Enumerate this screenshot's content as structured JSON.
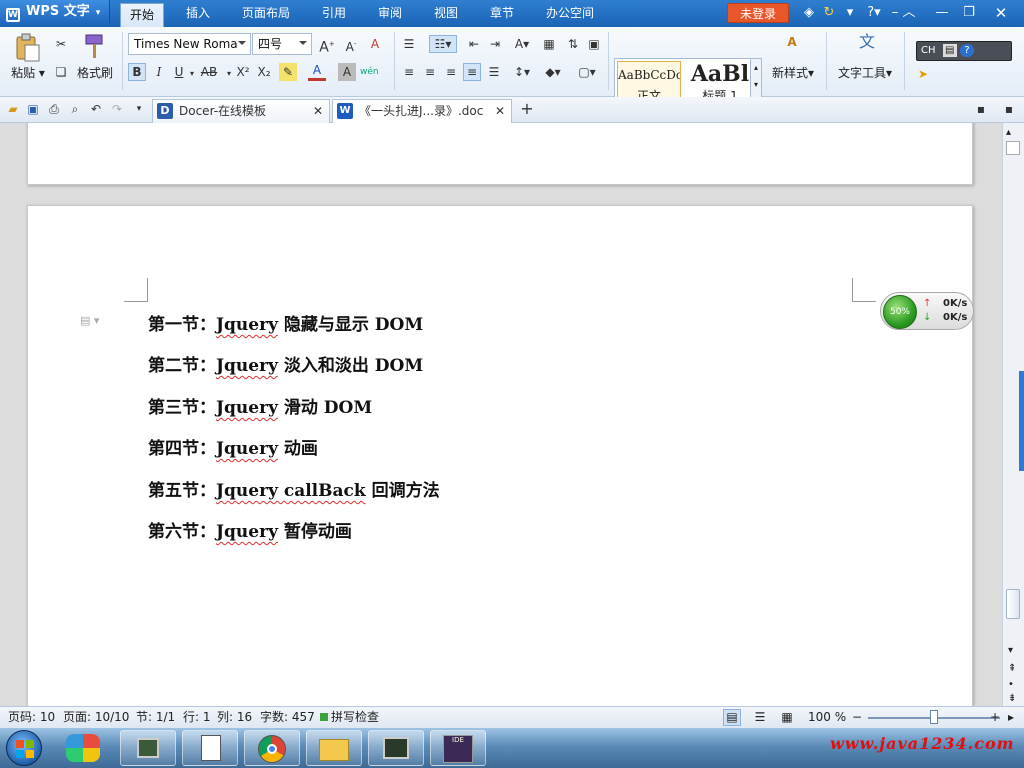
{
  "app": {
    "name": "WPS 文字",
    "login_label": "未登录"
  },
  "menu_tabs": [
    "开始",
    "插入",
    "页面布局",
    "引用",
    "审阅",
    "视图",
    "章节",
    "办公空间"
  ],
  "ribbon": {
    "paste_label": "粘贴",
    "format_painter_label": "格式刷",
    "font_name": "Times New Roma",
    "font_size": "四号",
    "style_normal_preview": "AaBbCcDc",
    "style_normal_label": "正文",
    "style_heading_preview": "AaBl",
    "style_heading_label": "标题 1",
    "new_style_label": "新样式",
    "text_tools_label": "文字工具",
    "ime_label": "CH"
  },
  "doc_tabs": [
    {
      "label": "Docer-在线模板"
    },
    {
      "label": "《一头扎进J...录》.doc"
    }
  ],
  "document": {
    "headings": [
      {
        "prefix": "第一节：",
        "kw": "Jquery",
        "rest": " 隐藏与显示 DOM"
      },
      {
        "prefix": "第二节：",
        "kw": "Jquery",
        "rest": " 淡入和淡出 DOM"
      },
      {
        "prefix": "第三节：",
        "kw": "Jquery",
        "rest": " 滑动 DOM"
      },
      {
        "prefix": "第四节：",
        "kw": "Jquery",
        "rest": " 动画"
      },
      {
        "prefix": "第五节：",
        "kw": "Jquery callBack",
        "rest": " 回调方法"
      },
      {
        "prefix": "第六节：",
        "kw": "Jquery",
        "rest": " 暂停动画"
      }
    ]
  },
  "net_widget": {
    "percent": "50%",
    "up": "0K/s",
    "down": "0K/s"
  },
  "status": {
    "page_code": "页码: 10",
    "pages": "页面: 10/10",
    "section": "节: 1/1",
    "row": "行: 1",
    "col": "列: 16",
    "word_count": "字数: 457",
    "spell_check": "拼写检查",
    "zoom": "100 %"
  },
  "watermark": "www.java1234.com",
  "colors": {
    "title_blue": "#1b63b5",
    "login_orange": "#e8562a",
    "spell_red": "#e03030"
  }
}
